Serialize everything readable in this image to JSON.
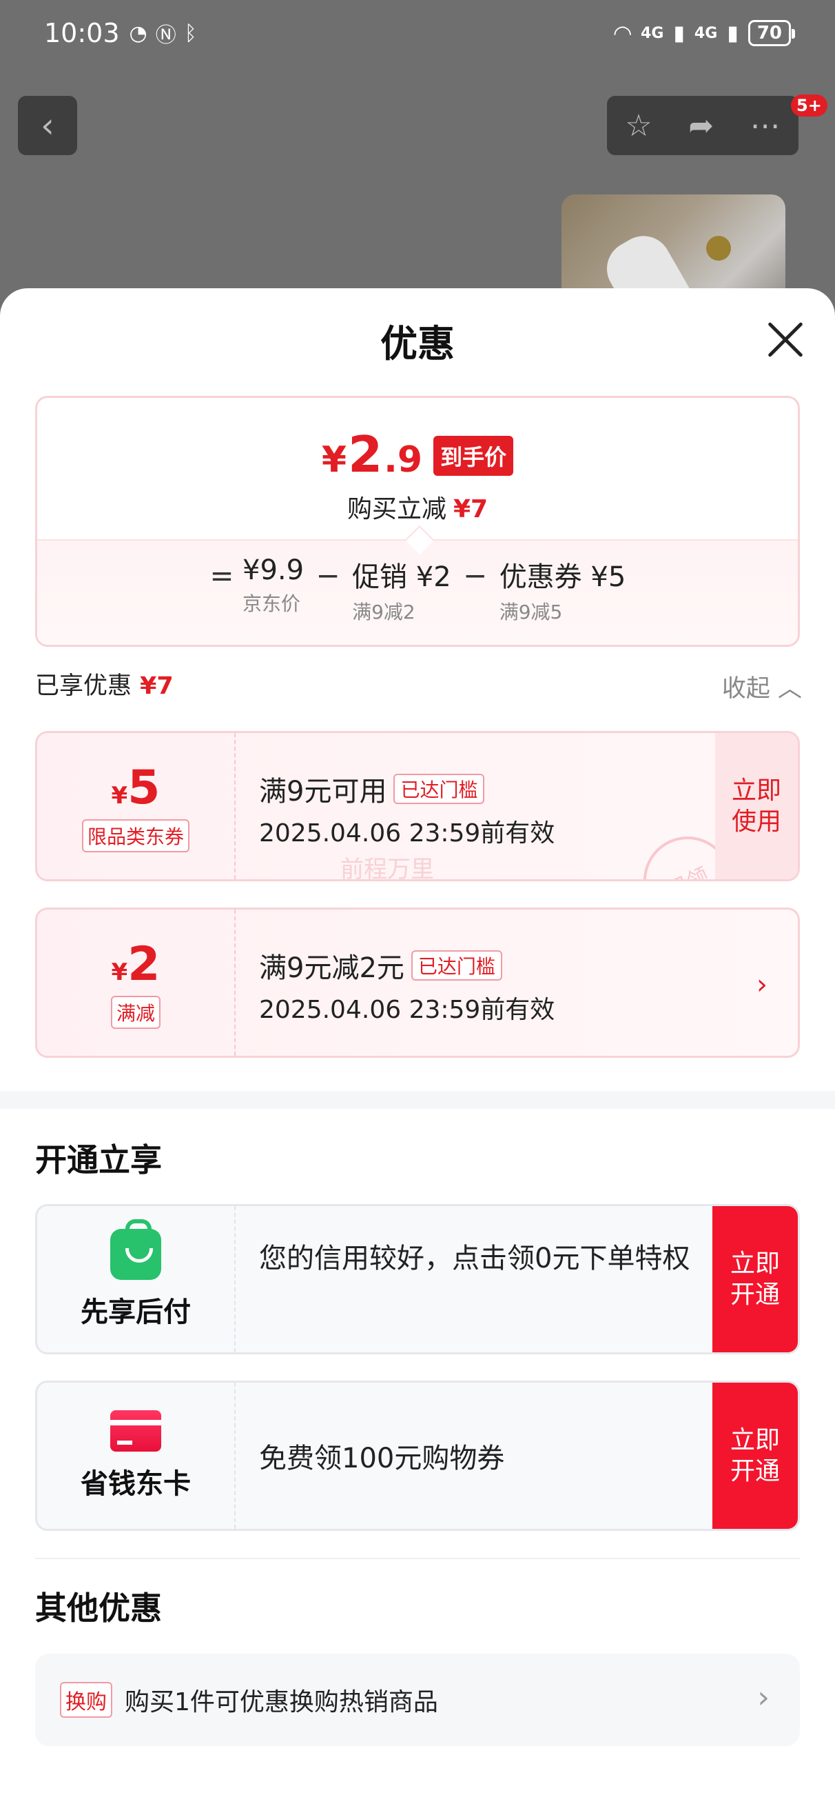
{
  "status": {
    "time": "10:03",
    "battery": "70",
    "network1": "4G",
    "network2": "4G"
  },
  "background": {
    "back_icon": "chevron-left-icon",
    "badge": "5+"
  },
  "sheet": {
    "title": "优惠",
    "close_icon": "close-icon"
  },
  "price_card": {
    "yen": "¥",
    "price_int": "2",
    "price_dec": ".9",
    "tag": "到手价",
    "sub_label": "购买立减",
    "sub_value": "¥7",
    "formula": {
      "eq": "=",
      "minus": "−",
      "items": [
        {
          "main": "¥9.9",
          "sub": "京东价"
        },
        {
          "main": "促销 ¥2",
          "sub": "满9减2"
        },
        {
          "main": "优惠券 ¥5",
          "sub": "满9减5"
        }
      ]
    }
  },
  "enjoyed": {
    "label": "已享优惠",
    "value": "¥7",
    "collapse": "收起 ︿"
  },
  "coupons": [
    {
      "yen": "¥",
      "amount": "5",
      "tag": "限品类东券",
      "title": "满9元可用",
      "badge": "已达门槛",
      "expiry": "2025.04.06 23:59前有效",
      "action": "立即使用",
      "watermark": "前程万里",
      "stamp": "已领"
    },
    {
      "yen": "¥",
      "amount": "2",
      "tag": "满减",
      "title": "满9元减2元",
      "badge": "已达门槛",
      "expiry": "2025.04.06 23:59前有效",
      "arrow": "›"
    }
  ],
  "open_section": {
    "title": "开通立享",
    "items": [
      {
        "name": "先享后付",
        "icon": "shopping-bag-icon",
        "text": "您的信用较好，点击领0元下单特权",
        "button": "立即开通"
      },
      {
        "name": "省钱东卡",
        "icon": "card-icon",
        "text": "免费领100元购物券",
        "button": "立即开通"
      }
    ]
  },
  "other_section": {
    "title": "其他优惠",
    "tag": "换购",
    "text": "购买1件可优惠换购热销商品",
    "arrow": "›"
  },
  "colors": {
    "accent": "#e21d24",
    "button_red": "#f3152d",
    "green": "#27c26b"
  }
}
